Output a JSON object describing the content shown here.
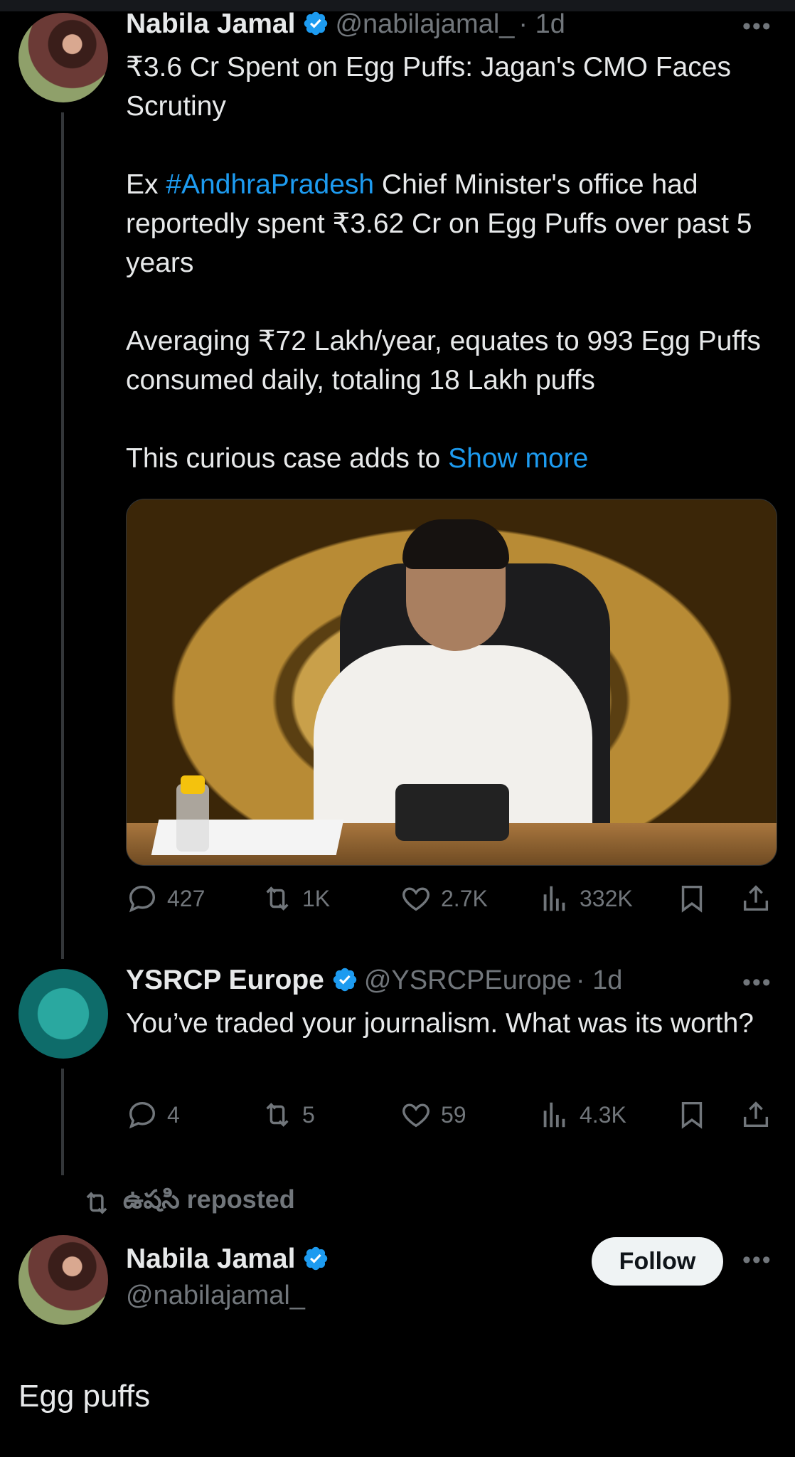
{
  "tweet1": {
    "author_name": "Nabila Jamal",
    "handle": "@nabilajamal_",
    "time": "· 1d",
    "more": "•••",
    "line_title": "₹3.6 Cr Spent on Egg Puffs: Jagan's CMO Faces Scrutiny",
    "p1_prefix": "Ex ",
    "p1_hashtag": "#AndhraPradesh",
    "p1_rest": " Chief Minister's office had reportedly spent ₹3.62 Cr on Egg Puffs over past 5 years",
    "p2": "Averaging ₹72 Lakh/year, equates to 993 Egg Puffs consumed daily, totaling 18 Lakh puffs",
    "p3_prefix": "This curious case adds to ",
    "show_more": "Show more",
    "stats": {
      "replies": "427",
      "reposts": "1K",
      "likes": "2.7K",
      "views": "332K"
    }
  },
  "tweet2": {
    "author_name": "YSRCP Europe",
    "handle": "@YSRCPEurope",
    "time": "· 1d",
    "more": "•••",
    "text": "You’ve traded your journalism. What was its worth?",
    "stats": {
      "replies": "4",
      "reposts": "5",
      "likes": "59",
      "views": "4.3K"
    }
  },
  "repost": {
    "label": "ఉషసి reposted"
  },
  "tweet3": {
    "author_name": "Nabila Jamal",
    "handle": "@nabilajamal_",
    "follow_label": "Follow",
    "more": "•••",
    "text": "Egg puffs"
  },
  "colors": {
    "background": "#000000",
    "accent": "#1d9bf0",
    "muted": "#71767b",
    "text": "#e7e9ea"
  }
}
